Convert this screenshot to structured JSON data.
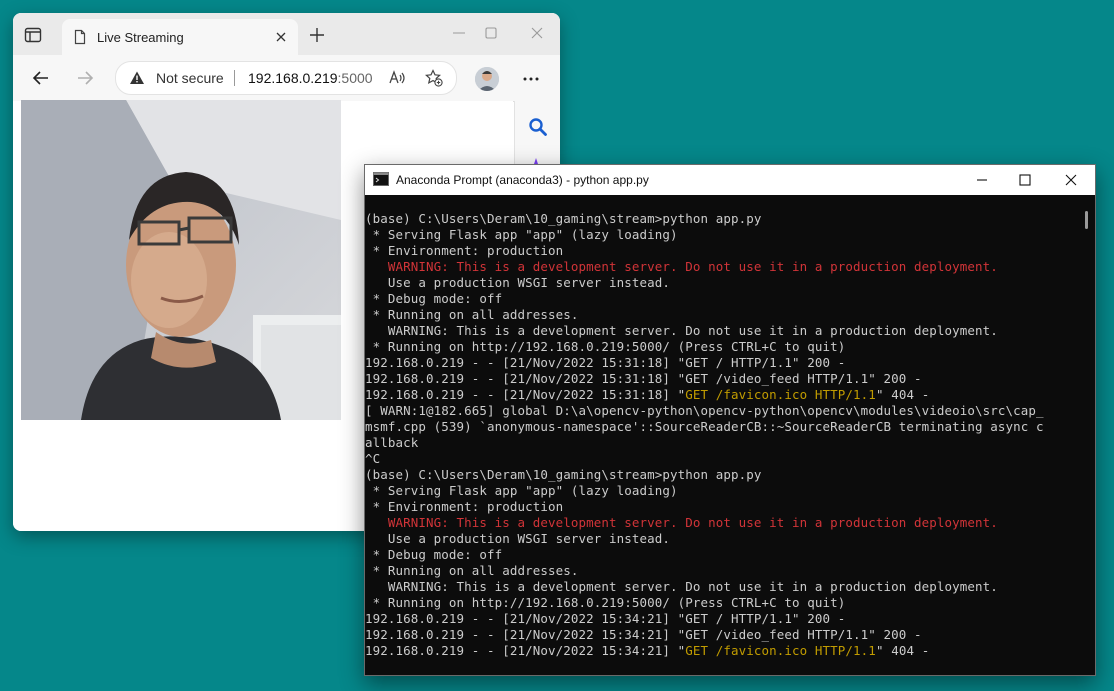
{
  "browser": {
    "tab_title": "Live Streaming",
    "address": {
      "security_label": "Not secure",
      "url_host": "192.168.0.219",
      "url_port": ":5000"
    },
    "icons": [
      "tab-actions-icon",
      "page-icon",
      "close-icon",
      "plus-icon",
      "minimize-icon",
      "maximize-icon",
      "back-icon",
      "forward-icon",
      "warning-icon",
      "read-aloud-icon",
      "add-favorite-icon",
      "avatar",
      "more-icon",
      "search-icon",
      "copilot-icon"
    ]
  },
  "terminal": {
    "title": "Anaconda Prompt (anaconda3) - python  app.py",
    "lines": [
      {
        "text": "(base) C:\\Users\\Deram\\10_gaming\\stream>python app.py",
        "color": "default"
      },
      {
        "text": " * Serving Flask app \"app\" (lazy loading)",
        "color": "default"
      },
      {
        "text": " * Environment: production",
        "color": "default"
      },
      {
        "text": "   WARNING: This is a development server. Do not use it in a production deployment.",
        "color": "red"
      },
      {
        "text": "   Use a production WSGI server instead.",
        "color": "default"
      },
      {
        "text": " * Debug mode: off",
        "color": "default"
      },
      {
        "text": " * Running on all addresses.",
        "color": "default"
      },
      {
        "text": "   WARNING: This is a development server. Do not use it in a production deployment.",
        "color": "default"
      },
      {
        "text": " * Running on http://192.168.0.219:5000/ (Press CTRL+C to quit)",
        "color": "default"
      },
      {
        "text": "192.168.0.219 - - [21/Nov/2022 15:31:18] \"GET / HTTP/1.1\" 200 -",
        "color": "default"
      },
      {
        "text": "192.168.0.219 - - [21/Nov/2022 15:31:18] \"GET /video_feed HTTP/1.1\" 200 -",
        "color": "default"
      },
      {
        "segments": [
          {
            "text": "192.168.0.219 - - [21/Nov/2022 15:31:18] \"",
            "color": "default"
          },
          {
            "text": "GET /favicon.ico HTTP/1.1",
            "color": "yellow"
          },
          {
            "text": "\" 404 -",
            "color": "default"
          }
        ]
      },
      {
        "text": "[ WARN:1@182.665] global D:\\a\\opencv-python\\opencv-python\\opencv\\modules\\videoio\\src\\cap_",
        "color": "default"
      },
      {
        "text": "msmf.cpp (539) `anonymous-namespace'::SourceReaderCB::~SourceReaderCB terminating async c",
        "color": "default"
      },
      {
        "text": "allback",
        "color": "default"
      },
      {
        "text": "^C",
        "color": "default"
      },
      {
        "text": "(base) C:\\Users\\Deram\\10_gaming\\stream>python app.py",
        "color": "default"
      },
      {
        "text": " * Serving Flask app \"app\" (lazy loading)",
        "color": "default"
      },
      {
        "text": " * Environment: production",
        "color": "default"
      },
      {
        "text": "   WARNING: This is a development server. Do not use it in a production deployment.",
        "color": "red"
      },
      {
        "text": "   Use a production WSGI server instead.",
        "color": "default"
      },
      {
        "text": " * Debug mode: off",
        "color": "default"
      },
      {
        "text": " * Running on all addresses.",
        "color": "default"
      },
      {
        "text": "   WARNING: This is a development server. Do not use it in a production deployment.",
        "color": "default"
      },
      {
        "text": " * Running on http://192.168.0.219:5000/ (Press CTRL+C to quit)",
        "color": "default"
      },
      {
        "text": "192.168.0.219 - - [21/Nov/2022 15:34:21] \"GET / HTTP/1.1\" 200 -",
        "color": "default"
      },
      {
        "text": "192.168.0.219 - - [21/Nov/2022 15:34:21] \"GET /video_feed HTTP/1.1\" 200 -",
        "color": "default"
      },
      {
        "segments": [
          {
            "text": "192.168.0.219 - - [21/Nov/2022 15:34:21] \"",
            "color": "default"
          },
          {
            "text": "GET /favicon.ico HTTP/1.1",
            "color": "yellow"
          },
          {
            "text": "\" 404 -",
            "color": "default"
          }
        ]
      }
    ]
  },
  "colors": {
    "desktop": "#05878a",
    "terminal_bg": "#0c0c0c",
    "terminal_text": "#cccccc",
    "warning_red": "#d13438",
    "highlight_yellow": "#c19c00"
  }
}
